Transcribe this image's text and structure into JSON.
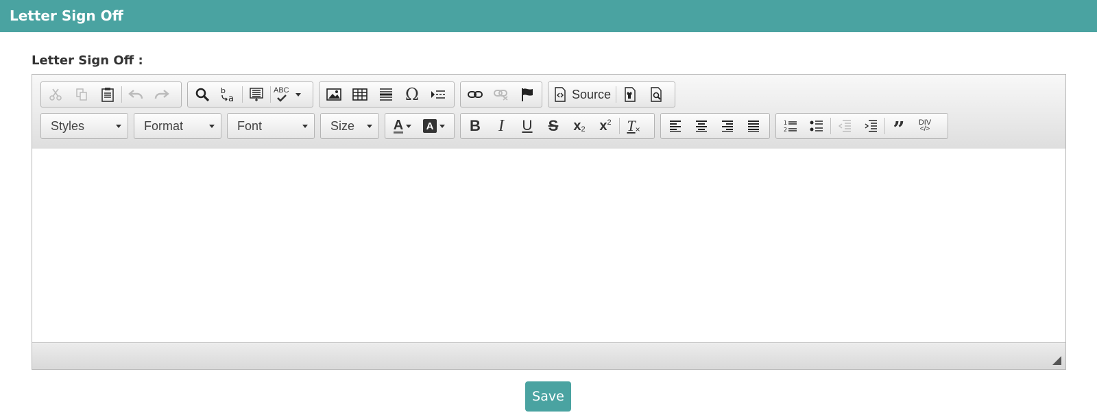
{
  "header": {
    "title": "Letter Sign Off"
  },
  "form": {
    "label": "Letter Sign Off :"
  },
  "toolbar": {
    "combos": {
      "styles": "Styles",
      "format": "Format",
      "font": "Font",
      "size": "Size"
    },
    "source_label": "Source",
    "spellcheck_label": "ABC",
    "div_label": "DIV"
  },
  "editor": {
    "content": ""
  },
  "actions": {
    "save_label": "Save"
  },
  "colors": {
    "header_bg": "#4aa3a1",
    "save_bg": "#4aa3a1",
    "toolbar_bg": "#e9e9e9"
  }
}
